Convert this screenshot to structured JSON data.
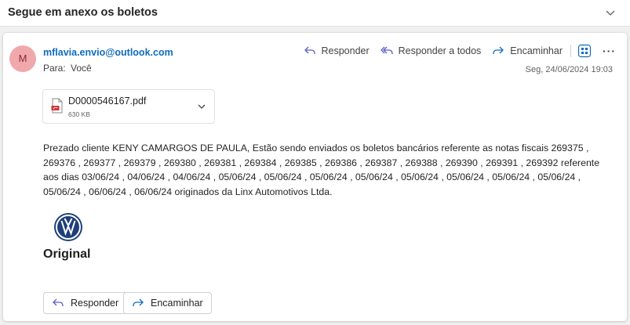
{
  "subject": "Segue em anexo os boletos",
  "message": {
    "avatar_initial": "M",
    "sender": "mflavia.envio@outlook.com",
    "to_label": "Para:",
    "to_value": "Você",
    "date": "Seg, 24/06/2024 19:03",
    "actions": {
      "reply": "Responder",
      "reply_all": "Responder a todos",
      "forward": "Encaminhar"
    },
    "attachment": {
      "name": "D0000546167.pdf",
      "size": "630 KB"
    },
    "body": "Prezado cliente KENY CAMARGOS DE PAULA, Estão sendo enviados os boletos bancários referente as notas fiscais 269375 , 269376 , 269377 , 269379 , 269380 , 269381 , 269384 , 269385 , 269386 , 269387 , 269388 , 269390 , 269391 , 269392 referente aos dias 03/06/24 , 04/06/24 , 04/06/24 , 05/06/24 , 05/06/24 , 05/06/24 , 05/06/24 , 05/06/24 , 05/06/24 , 05/06/24 , 05/06/24 , 05/06/24 , 06/06/24 , 06/06/24 originados da Linx Automotivos Ltda.",
    "logo_text": "Original"
  },
  "footer_buttons": {
    "reply": "Responder",
    "forward": "Encaminhar"
  },
  "colors": {
    "link_blue": "#0f6cbd",
    "reply_icon_purple": "#5b5fc7",
    "forward_icon_blue": "#0f6cbd",
    "avatar_bg": "#f0a8ad",
    "vw_blue": "#1e3f7a"
  }
}
